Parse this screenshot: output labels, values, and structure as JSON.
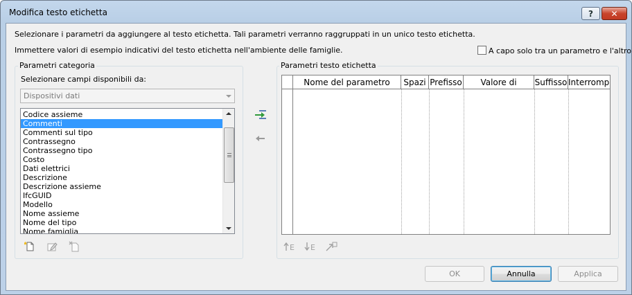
{
  "window": {
    "title": "Modifica testo etichetta",
    "help_label": "?",
    "close_label": "✕"
  },
  "instructions": {
    "line1": "Selezionare i parametri da aggiungere al testo etichetta. Tali parametri verranno raggruppati in un unico testo etichetta.",
    "line2": "Immettere valori di esempio indicativi del testo etichetta nell'ambiente delle famiglie."
  },
  "wrap_option": {
    "label": "A capo solo tra un parametro e l'altro",
    "checked": false
  },
  "category_params": {
    "group_label": "Parametri categoria",
    "select_label": "Selezionare campi disponibili da:",
    "source_value": "Dispositivi dati",
    "items": [
      "Codice assieme",
      "Commenti",
      "Commenti sul tipo",
      "Contrassegno",
      "Contrassegno tipo",
      "Costo",
      "Dati elettrici",
      "Descrizione",
      "Descrizione assieme",
      "IfcGUID",
      "Modello",
      "Nome assieme",
      "Nome del tipo",
      "Nome famiglia"
    ],
    "selected_index": 1
  },
  "label_params": {
    "group_label": "Parametri testo etichetta",
    "columns": [
      "Nome del parametro",
      "Spazi",
      "Prefisso",
      "Valore di esempio",
      "Suffisso",
      "Interrompi"
    ],
    "rows": []
  },
  "icons": {
    "add": "add-parameter-icon",
    "remove": "remove-parameter-icon",
    "new_param": "new-parameter-icon",
    "edit_param": "edit-parameter-icon",
    "delete_param": "delete-parameter-icon",
    "move_up": "move-up-icon",
    "move_down": "move-down-icon",
    "sort": "sort-icon"
  },
  "buttons": {
    "ok": "OK",
    "cancel": "Annulla",
    "apply": "Applica"
  }
}
